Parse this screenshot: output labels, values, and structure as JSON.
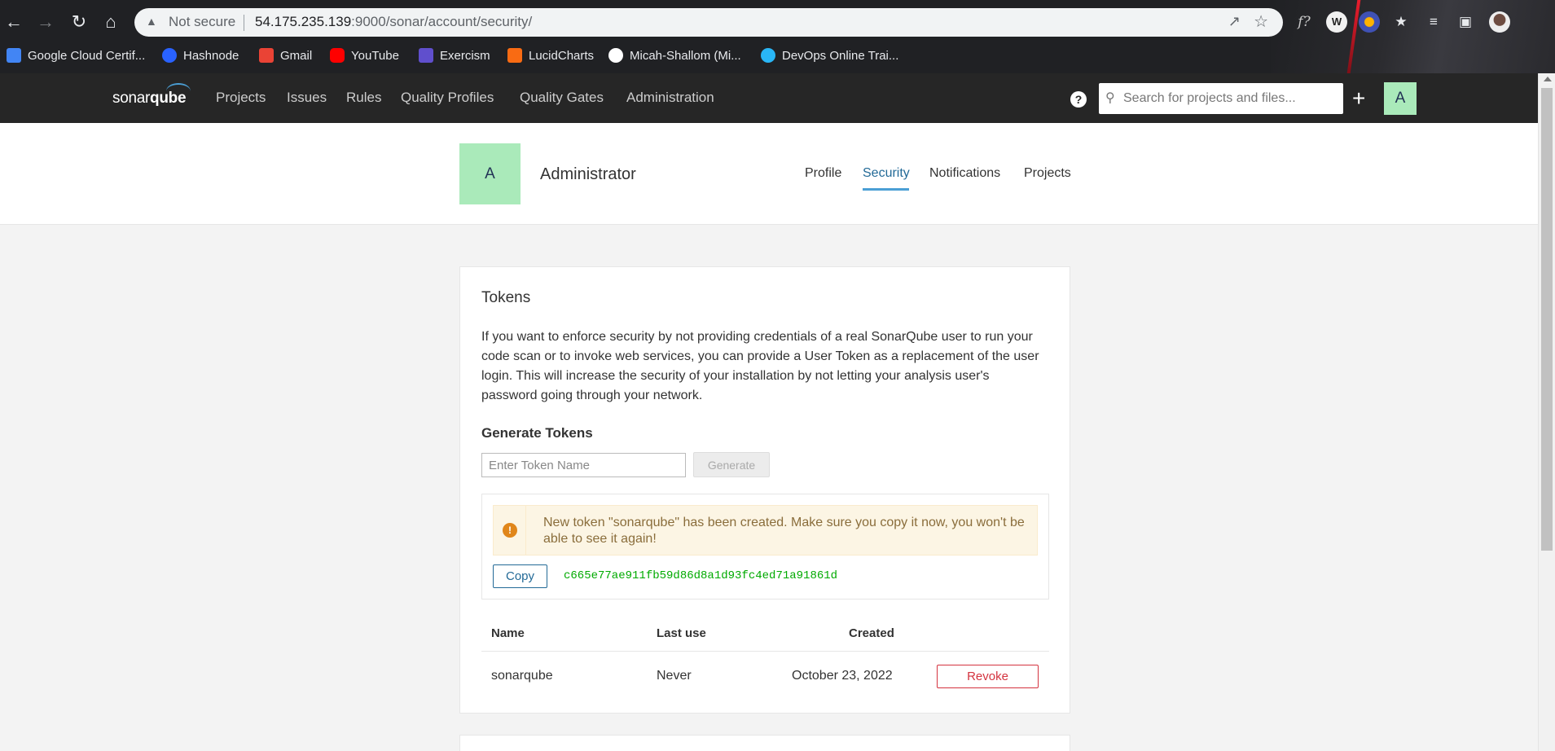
{
  "browser": {
    "security_label": "Not secure",
    "url_host": "54.175.235.139",
    "url_path": ":9000/sonar/account/security/",
    "bookmarks": [
      {
        "label": "Google Cloud Certif...",
        "color": "#4285f4"
      },
      {
        "label": "Hashnode",
        "color": "#2962ff"
      },
      {
        "label": "Gmail",
        "color": "#ea4335"
      },
      {
        "label": "YouTube",
        "color": "#ff0000"
      },
      {
        "label": "Exercism",
        "color": "#604fcd"
      },
      {
        "label": "LucidCharts",
        "color": "#f96b13"
      },
      {
        "label": "Micah-Shallom (Mi...",
        "color": "#ffffff"
      },
      {
        "label": "DevOps Online Trai...",
        "color": "#29b6f6"
      }
    ],
    "extensions": [
      "f?",
      "W"
    ]
  },
  "sonar_nav": {
    "logo_prefix": "sonar",
    "logo_suffix": "qube",
    "menu": [
      "Projects",
      "Issues",
      "Rules",
      "Quality Profiles",
      "Quality Gates",
      "Administration"
    ],
    "help_label": "?",
    "search_placeholder": "Search for projects and files...",
    "plus_label": "+",
    "avatar_letter": "A"
  },
  "account": {
    "avatar_letter": "A",
    "name": "Administrator",
    "tabs": [
      "Profile",
      "Security",
      "Notifications",
      "Projects"
    ],
    "active_tab": "Security"
  },
  "tokens": {
    "title": "Tokens",
    "description": "If you want to enforce security by not providing credentials of a real SonarQube user to run your code scan or to invoke web services, you can provide a User Token as a replacement of the user login. This will increase the security of your installation by not letting your analysis user's password going through your network.",
    "generate_title": "Generate Tokens",
    "input_placeholder": "Enter Token Name",
    "generate_label": "Generate",
    "alert_icon": "!",
    "alert_text": "New token \"sonarqube\" has been created. Make sure you copy it now, you won't be able to see it again!",
    "copy_label": "Copy",
    "token_value": "c665e77ae911fb59d86d8a1d93fc4ed71a91861d",
    "columns": {
      "name": "Name",
      "last_use": "Last use",
      "created": "Created"
    },
    "rows": [
      {
        "name": "sonarqube",
        "last_use": "Never",
        "created": "October 23, 2022",
        "action": "Revoke"
      }
    ]
  }
}
